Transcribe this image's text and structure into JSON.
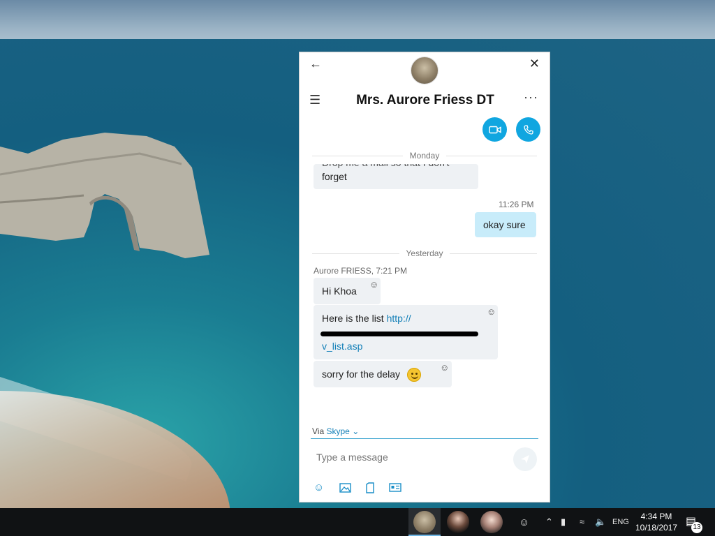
{
  "chat": {
    "contact_name": "Mrs. Aurore Friess DT",
    "day_labels": {
      "monday": "Monday",
      "yesterday": "Yesterday"
    },
    "messages": {
      "m1_text": "forget",
      "m1_partial": "Drop me a mail so that I don't",
      "m2_time": "11:26 PM",
      "m2_text": "okay sure",
      "group_header": "Aurore FRIESS, 7:21 PM",
      "m3_text": "Hi Khoa",
      "m4_prefix": "Here is the list ",
      "m4_link_start": "http://",
      "m4_link_end": "v_list.asp",
      "m5_text": "sorry for the delay"
    }
  },
  "composer": {
    "via_label": "Via",
    "via_service": "Skype",
    "placeholder": "Type a message"
  },
  "icons": {
    "back": "back-arrow-icon",
    "close": "close-icon",
    "menu": "hamburger-menu-icon",
    "more": "more-options-icon",
    "video": "video-call-icon",
    "call": "audio-call-icon",
    "react": "emoji-reaction-icon",
    "send": "send-icon",
    "emoji": "emoji-icon",
    "image": "image-icon",
    "file": "file-icon",
    "contact": "contact-card-icon"
  },
  "taskbar": {
    "language": "ENG",
    "time": "4:34 PM",
    "date": "10/18/2017",
    "notification_count": "13"
  },
  "colors": {
    "accent": "#10a6e0",
    "my_bubble": "#c8ecfa",
    "their_bubble": "#eef1f4",
    "link": "#1480b8"
  }
}
